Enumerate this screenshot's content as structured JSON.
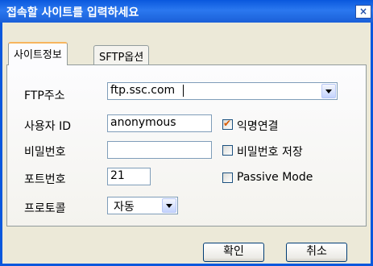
{
  "window": {
    "title": "접속할 사이트를 입력하세요",
    "close_symbol": "×"
  },
  "tabs": [
    {
      "label": "사이트정보",
      "selected": true
    },
    {
      "label": "SFTP옵션",
      "selected": false
    }
  ],
  "form": {
    "ftp_address": {
      "label": "FTP주소",
      "value": "ftp.ssc.com"
    },
    "user_id": {
      "label": "사용자 ID",
      "value": "anonymous"
    },
    "password": {
      "label": "비밀번호",
      "value": ""
    },
    "port": {
      "label": "포트번호",
      "value": "21"
    },
    "protocol": {
      "label": "프로토콜",
      "selected": "자동"
    }
  },
  "options": {
    "anonymous": {
      "label": "익명연결",
      "checked": true
    },
    "save_password": {
      "label": "비밀번호 저장",
      "checked": false
    },
    "passive_mode": {
      "label": "Passive Mode",
      "checked": false
    }
  },
  "buttons": {
    "ok": "확인",
    "cancel": "취소"
  },
  "colors": {
    "titlebar": "#0a58dd",
    "dialog_bg": "#ece9d8",
    "check_mark": "#d95a00",
    "tab_highlight": "#f7b55e"
  }
}
